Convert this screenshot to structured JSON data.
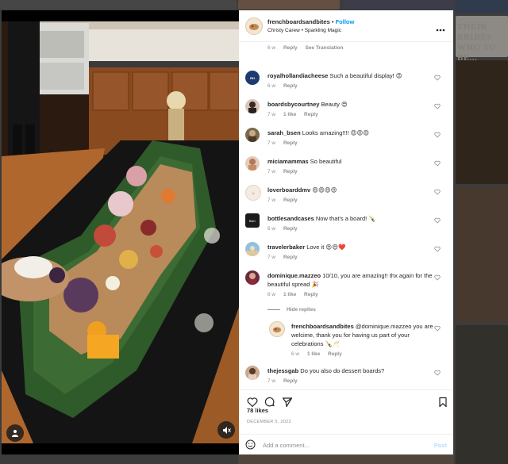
{
  "background": {
    "headline": "THEIR BRIDES WHO TO BE..."
  },
  "post": {
    "author": {
      "username": "frenchboardsandbites",
      "follow_label": "Follow",
      "subtitle": "Christy Carew • Sparkling Magic"
    },
    "more_icon": "more-horizontal-icon",
    "caption_meta": {
      "time": "6 w",
      "reply": "Reply",
      "translation": "See Translation"
    },
    "likes": "78 likes",
    "date": "DECEMBER 5, 2022",
    "add_comment_placeholder": "Add a comment...",
    "post_label": "Post"
  },
  "comments": [
    {
      "username": "royalhollandiacheese",
      "text": "Such a beautiful display! 😍",
      "time": "6 w",
      "likes": "",
      "reply": "Reply"
    },
    {
      "username": "boardsbycourtney",
      "text": "Beauty 😍",
      "time": "7 w",
      "likes": "1 like",
      "reply": "Reply"
    },
    {
      "username": "sarah_bsen",
      "text": "Looks amazing!!!! 😍😍😍",
      "time": "7 w",
      "likes": "",
      "reply": "Reply"
    },
    {
      "username": "miciamammas",
      "text": "So beautiful",
      "time": "7 w",
      "likes": "",
      "reply": "Reply"
    },
    {
      "username": "loverboarddmv",
      "text": "😍😍😍😍",
      "time": "7 w",
      "likes": "",
      "reply": "Reply"
    },
    {
      "username": "bottlesandcases",
      "text": "Now that's a board! 🍾",
      "time": "6 w",
      "likes": "",
      "reply": "Reply"
    },
    {
      "username": "travelerbaker",
      "text": "Love it 😍😍❤️",
      "time": "7 w",
      "likes": "",
      "reply": "Reply"
    },
    {
      "username": "dominique.mazzeo",
      "text": "10/10, you are amazing!! thx again for the beautiful spread 🎉",
      "time": "6 w",
      "likes": "1 like",
      "reply": "Reply",
      "hide_replies": "Hide replies"
    },
    {
      "username": "frenchboardsandbites",
      "text": "@dominique.mazzeo you are welcime, thank you for having us part of your celebrations 🍾🥂",
      "time": "6 w",
      "likes": "1 like",
      "reply": "Reply"
    },
    {
      "username": "thejessgab",
      "text": "Do you also do dessert boards?",
      "time": "7 w",
      "likes": "",
      "reply": "Reply"
    }
  ],
  "colors": {
    "link_blue": "#0095f6",
    "muted_text": "#8e8e8e",
    "post_disabled": "#b2dffc"
  }
}
